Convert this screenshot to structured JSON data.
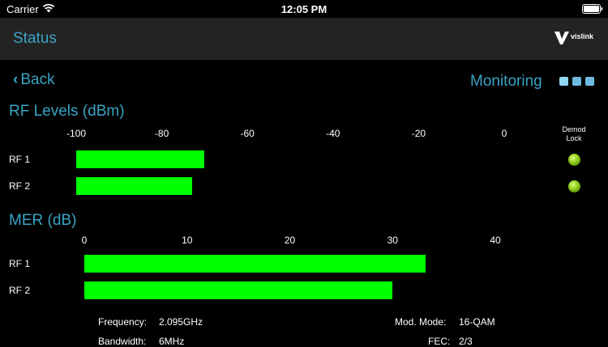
{
  "status_bar": {
    "carrier": "Carrier",
    "time": "12:05 PM"
  },
  "header": {
    "title": "Status",
    "brand": "vislink"
  },
  "nav": {
    "back_label": "Back",
    "monitoring_label": "Monitoring",
    "page_dots": 3
  },
  "rf_levels": {
    "title": "RF Levels (dBm)",
    "ticks": [
      "-100",
      "-80",
      "-60",
      "-40",
      "-20",
      "0"
    ],
    "range": [
      -100,
      0
    ],
    "demod_lock_header": "Demod Lock",
    "rows": [
      {
        "label": "RF 1",
        "value": -70,
        "demod_lock": true
      },
      {
        "label": "RF 2",
        "value": -73,
        "demod_lock": true
      }
    ]
  },
  "mer": {
    "title": "MER (dB)",
    "ticks": [
      "0",
      "10",
      "20",
      "30",
      "40"
    ],
    "range": [
      0,
      40
    ],
    "rows": [
      {
        "label": "RF 1",
        "value": 33.2
      },
      {
        "label": "RF 2",
        "value": 30.0
      }
    ]
  },
  "info": {
    "frequency_label": "Frequency:",
    "frequency_value": "2.095GHz",
    "mod_mode_label": "Mod. Mode:",
    "mod_mode_value": "16-QAM",
    "bandwidth_label": "Bandwidth:",
    "bandwidth_value": "6MHz",
    "fec_label": "FEC:",
    "fec_value": "2/3"
  },
  "colors": {
    "accent": "#3aa3c4",
    "bar": "#00ff00",
    "header_bg": "#232323",
    "dot": "#8fd6f2"
  }
}
